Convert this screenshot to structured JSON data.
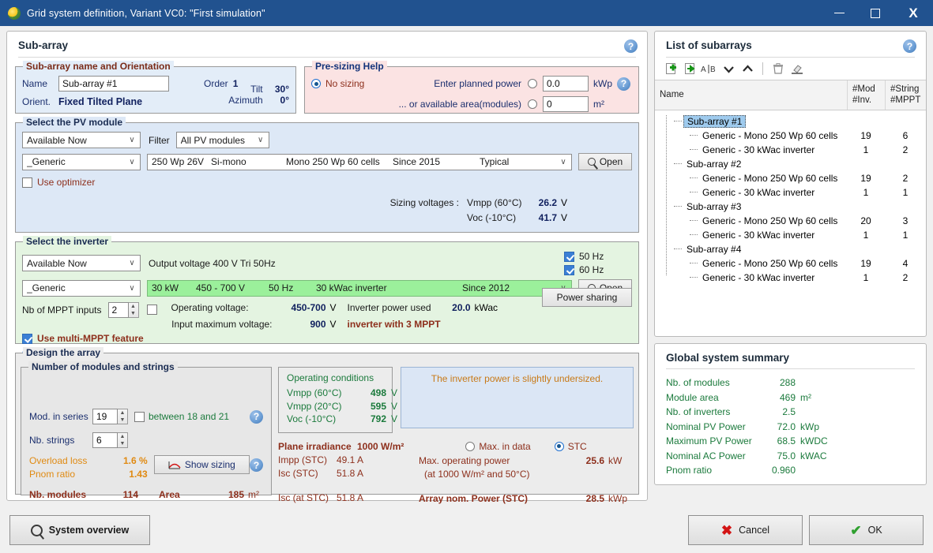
{
  "window": {
    "title": "Grid system definition, Variant VC0:  \"First simulation\"",
    "minimize": "—",
    "maximize": "□",
    "close": "X"
  },
  "subarray_panel": {
    "title": "Sub-array",
    "help": "?",
    "name_group": {
      "legend": "Sub-array name and Orientation",
      "name_label": "Name",
      "name_value": "Sub-array #1",
      "order_label": "Order",
      "order_value": "1",
      "orient_label": "Orient.",
      "orient_value": "Fixed Tilted Plane",
      "tilt_label": "Tilt",
      "tilt_value": "30°",
      "azimuth_label": "Azimuth",
      "azimuth_value": "0°"
    },
    "presizing": {
      "legend": "Pre-sizing Help",
      "no_sizing_label": "No sizing",
      "planned_power_label": "Enter planned power",
      "planned_power_value": "0.0",
      "planned_power_unit": "kWp",
      "available_area_label": "... or available area(modules)",
      "available_area_value": "0",
      "available_area_unit": "m²",
      "help": "?"
    },
    "pv_module": {
      "legend": "Select the PV module",
      "availability": "Available Now",
      "filter_label": "Filter",
      "filter_value": "All PV modules",
      "manufacturer": "_Generic",
      "model_power": "250 Wp 26V",
      "model_tech": "Si-mono",
      "model_name": "Mono 250 Wp  60 cells",
      "model_since": "Since 2015",
      "model_quality": "Typical",
      "open_button": "Open",
      "use_optimizer": "Use optimizer",
      "sizing_voltages_label": "Sizing voltages :",
      "vmpp_label": "Vmpp (60°C)",
      "vmpp_value": "26.2",
      "vmpp_unit": "V",
      "voc_label": "Voc (-10°C)",
      "voc_value": "41.7",
      "voc_unit": "V"
    },
    "inverter": {
      "legend": "Select the inverter",
      "availability": "Available Now",
      "output_voltage": "Output voltage 400 V Tri 50Hz",
      "manufacturer": "_Generic",
      "model_power": "30 kW",
      "model_range": "450 - 700 V",
      "model_freq": "50 Hz",
      "model_name": "30 kWac inverter",
      "model_since": "Since 2012",
      "open_button": "Open",
      "freq_50": "50 Hz",
      "freq_60": "60 Hz",
      "mppt_inputs_label": "Nb of MPPT inputs",
      "mppt_inputs_value": "2",
      "operating_voltage_label": "Operating voltage:",
      "operating_voltage_value": "450-700",
      "operating_voltage_unit": "V",
      "inverter_power_used_label": "Inverter power used",
      "inverter_power_used_value": "20.0",
      "inverter_power_used_unit": "kWac",
      "power_sharing_button": "Power sharing",
      "multi_mppt_label": "Use multi-MPPT feature",
      "input_max_voltage_label": "Input maximum voltage:",
      "input_max_voltage_value": "900",
      "input_max_voltage_unit": "V",
      "inverter_mppt_note": "inverter with 3 MPPT",
      "help": "?"
    },
    "design": {
      "legend": "Design the array",
      "nb_legend": "Number of modules and strings",
      "mod_series_label": "Mod. in series",
      "mod_series_value": "19",
      "between_label": "between 18 and 21",
      "nb_strings_label": "Nb. strings",
      "nb_strings_value": "6",
      "overload_loss_label": "Overload loss",
      "overload_loss_value": "1.6 %",
      "pnom_ratio_label": "Pnom ratio",
      "pnom_ratio_value": "1.43",
      "show_sizing_button": "Show sizing",
      "nb_modules_label": "Nb. modules",
      "nb_modules_value": "114",
      "area_label": "Area",
      "area_value": "185",
      "area_unit": "m²",
      "help": "?",
      "operating_conditions": {
        "title": "Operating conditions",
        "rows": [
          {
            "label": "Vmpp (60°C)",
            "value": "498",
            "unit": "V"
          },
          {
            "label": "Vmpp (20°C)",
            "value": "595",
            "unit": "V"
          },
          {
            "label": "Voc (-10°C)",
            "value": "792",
            "unit": "V"
          }
        ]
      },
      "warning_message": "The inverter power is slightly undersized.",
      "plane_irradiance_label": "Plane irradiance",
      "plane_irradiance_value": "1000 W/m²",
      "impp_label": "Impp (STC)",
      "impp_value": "49.1 A",
      "isc_label": "Isc (STC)",
      "isc_value": "51.8 A",
      "isc_at_label": "Isc (at STC)",
      "isc_at_value": "51.8 A",
      "max_in_data_label": "Max. in data",
      "stc_label": "STC",
      "max_op_power_label": "Max. operating power",
      "max_op_power_cond": "(at 1000 W/m²  and 50°C)",
      "max_op_power_value": "25.6",
      "max_op_power_unit": "kW",
      "array_nom_power_label": "Array nom. Power (STC)",
      "array_nom_power_value": "28.5",
      "array_nom_power_unit": "kWp"
    }
  },
  "list_panel": {
    "title": "List of subarrays",
    "help": "?",
    "toolbar": [
      {
        "name": "add-subarray-icon",
        "glyph": "+"
      },
      {
        "name": "duplicate-subarray-icon",
        "glyph": "→"
      },
      {
        "name": "rename-subarray-icon",
        "glyph": "A|B"
      },
      {
        "name": "move-down-icon",
        "glyph": "∨"
      },
      {
        "name": "move-up-icon",
        "glyph": "∧"
      },
      {
        "name": "delete-subarray-icon",
        "glyph": "🗑"
      },
      {
        "name": "clear-subarray-icon",
        "glyph": "◢"
      }
    ],
    "columns": {
      "name": "Name",
      "mod_inv": "#Mod\n#Inv.",
      "mod_line1": "#Mod",
      "mod_line2": "#Inv.",
      "str_line1": "#String",
      "str_line2": "#MPPT"
    },
    "rows": [
      {
        "level": 0,
        "label": "Sub-array #1",
        "c1": "",
        "c2": "",
        "selected": true
      },
      {
        "level": 1,
        "label": "Generic - Mono 250 Wp  60 cells",
        "c1": "19",
        "c2": "6",
        "selected": false
      },
      {
        "level": 1,
        "label": "Generic - 30 kWac inverter",
        "c1": "1",
        "c2": "2",
        "selected": false
      },
      {
        "level": 0,
        "label": "Sub-array #2",
        "c1": "",
        "c2": "",
        "selected": false
      },
      {
        "level": 1,
        "label": "Generic - Mono 250 Wp  60 cells",
        "c1": "19",
        "c2": "2",
        "selected": false
      },
      {
        "level": 1,
        "label": "Generic - 30 kWac inverter",
        "c1": "1",
        "c2": "1",
        "selected": false
      },
      {
        "level": 0,
        "label": "Sub-array #3",
        "c1": "",
        "c2": "",
        "selected": false
      },
      {
        "level": 1,
        "label": "Generic - Mono 250 Wp  60 cells",
        "c1": "20",
        "c2": "3",
        "selected": false
      },
      {
        "level": 1,
        "label": "Generic - 30 kWac inverter",
        "c1": "1",
        "c2": "1",
        "selected": false
      },
      {
        "level": 0,
        "label": "Sub-array #4",
        "c1": "",
        "c2": "",
        "selected": false
      },
      {
        "level": 1,
        "label": "Generic - Mono 250 Wp  60 cells",
        "c1": "19",
        "c2": "4",
        "selected": false
      },
      {
        "level": 1,
        "label": "Generic - 30 kWac inverter",
        "c1": "1",
        "c2": "2",
        "selected": false
      }
    ]
  },
  "summary_panel": {
    "title": "Global system summary",
    "rows": [
      {
        "label": "Nb. of modules",
        "value": "288",
        "unit": ""
      },
      {
        "label": "Module area",
        "value": "469",
        "unit": "m²"
      },
      {
        "label": "Nb. of inverters",
        "value": "2.5",
        "unit": ""
      },
      {
        "label": "Nominal PV Power",
        "value": "72.0",
        "unit": "kWp"
      },
      {
        "label": "Maximum PV Power",
        "value": "68.5",
        "unit": "kWDC"
      },
      {
        "label": "Nominal AC Power",
        "value": "75.0",
        "unit": "kWAC"
      },
      {
        "label": "Pnom ratio",
        "value": "0.960",
        "unit": ""
      }
    ]
  },
  "footer": {
    "system_overview": "System overview",
    "cancel": "Cancel",
    "ok": "OK"
  },
  "colors": {
    "titlebar": "#21528f",
    "accent_blue": "#1b2f6e",
    "dark_red": "#8d2f1c",
    "green": "#1b7a3c",
    "orange": "#e08a12",
    "selection": "#9fcbee"
  }
}
